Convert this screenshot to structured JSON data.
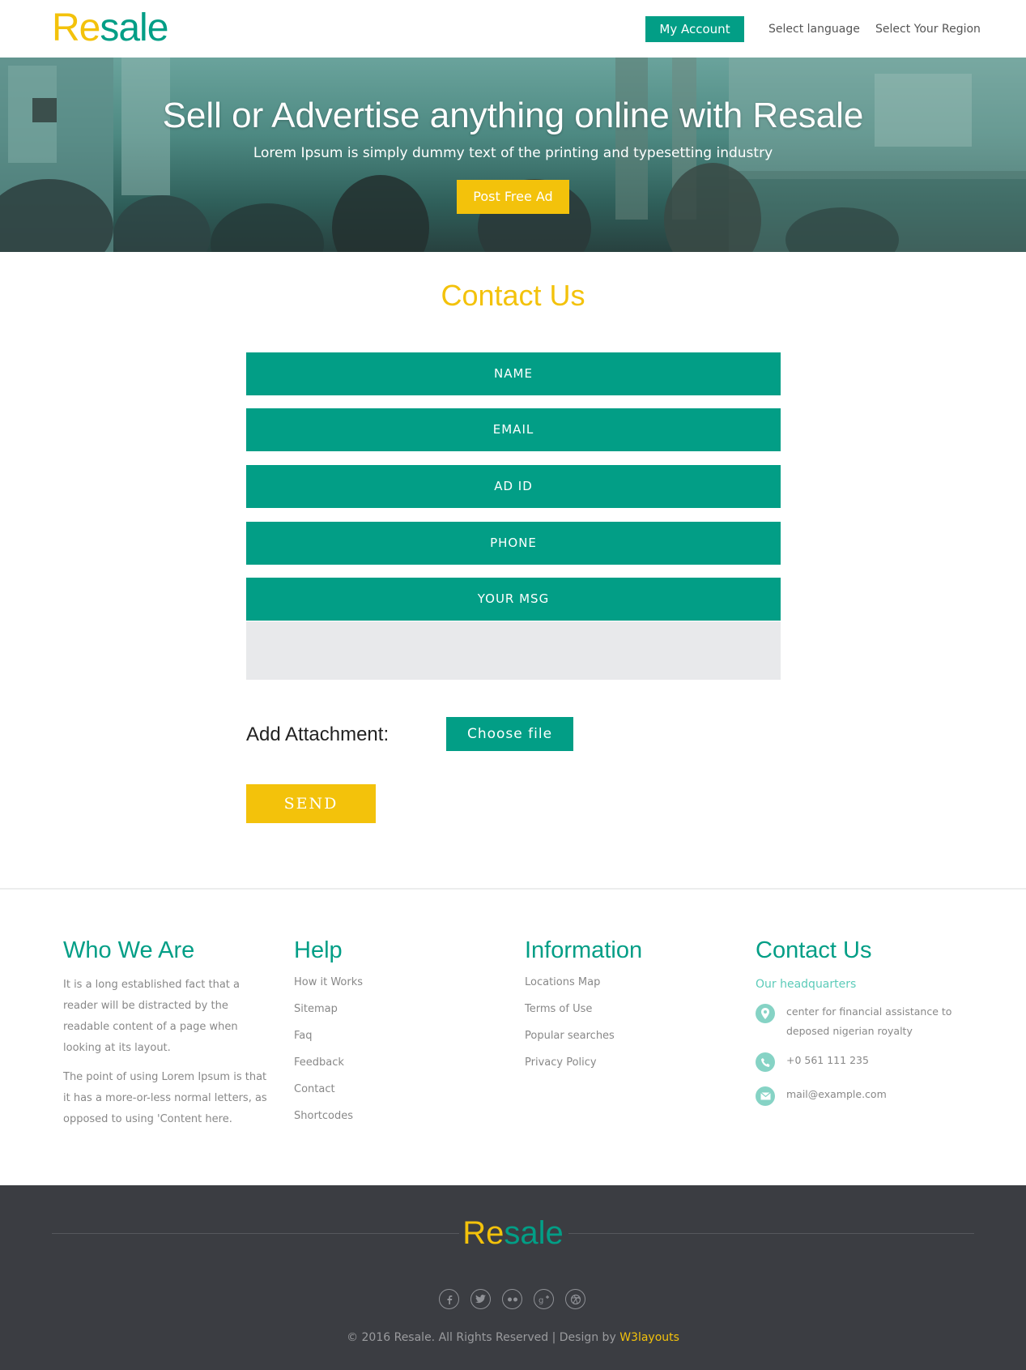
{
  "header": {
    "logo": {
      "part1": "Re",
      "part2": "sale"
    },
    "account_label": "My Account",
    "language_label": "Select language",
    "region_label": "Select Your Region"
  },
  "banner": {
    "title": "Sell or Advertise anything online with Resale",
    "subtitle": "Lorem Ipsum is simply dummy text of the printing and typesetting industry",
    "cta_label": "Post Free Ad"
  },
  "contact": {
    "title": "Contact Us",
    "fields": [
      "NAME",
      "EMAIL",
      "AD ID",
      "PHONE",
      "YOUR MSG"
    ],
    "message_value": "",
    "attachment_label": "Add Attachment:",
    "choose_file_label": "Choose file",
    "send_label": "SEND"
  },
  "footer": {
    "who": {
      "title": "Who We Are",
      "para1": "It is a long established fact that a reader will be distracted by the readable content of a page when looking at its layout.",
      "para2": "The point of using Lorem Ipsum is that it has a more-or-less normal letters, as opposed to using 'Content here."
    },
    "help": {
      "title": "Help",
      "links": [
        "How it Works",
        "Sitemap",
        "Faq",
        "Feedback",
        "Contact",
        "Shortcodes"
      ]
    },
    "information": {
      "title": "Information",
      "links": [
        "Locations Map",
        "Terms of Use",
        "Popular searches",
        "Privacy Policy"
      ]
    },
    "contact": {
      "title": "Contact Us",
      "subtitle": "Our headquarters",
      "address": "center for financial assistance to deposed nigerian royalty",
      "phone": "+0 561 111 235",
      "email": "mail@example.com",
      "icons": [
        "location-pin-icon",
        "phone-icon",
        "mail-icon"
      ]
    }
  },
  "bottom": {
    "logo": {
      "part1": "Re",
      "part2": "sale"
    },
    "socials": [
      "facebook-icon",
      "twitter-icon",
      "flickr-icon",
      "google-plus-icon",
      "dribbble-icon"
    ],
    "copyright": "© 2016 Resale. All Rights Reserved | Design by",
    "designer": "W3layouts"
  },
  "colors": {
    "teal": "#029e86",
    "yellow": "#f3c20b",
    "dark_footer": "#3b3d42",
    "light_teal": "#86d3c5"
  }
}
